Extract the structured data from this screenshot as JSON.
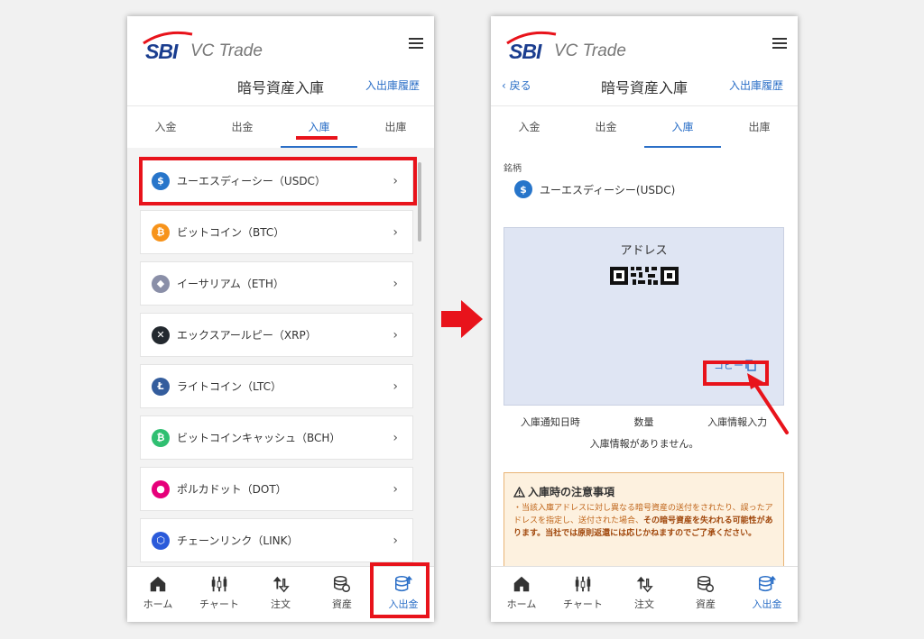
{
  "app": {
    "brand_sbi": "SBI",
    "brand_vc": "VC Trade"
  },
  "left": {
    "title": "暗号資産入庫",
    "history_link": "入出庫履歴",
    "tabs": [
      {
        "label": "入金"
      },
      {
        "label": "出金"
      },
      {
        "label": "入庫"
      },
      {
        "label": "出庫"
      }
    ],
    "active_tab": "入庫",
    "coins": [
      {
        "label": "ユーエスディーシー（USDC）",
        "icon": "usdc-icon",
        "color": "#2775ca",
        "glyph": "$"
      },
      {
        "label": "ビットコイン（BTC）",
        "icon": "btc-icon",
        "color": "#f7931a",
        "glyph": "₿"
      },
      {
        "label": "イーサリアム（ETH）",
        "icon": "eth-icon",
        "color": "#8a8fa8",
        "glyph": "◆"
      },
      {
        "label": "エックスアールピー（XRP）",
        "icon": "xrp-icon",
        "color": "#23292f",
        "glyph": "✕"
      },
      {
        "label": "ライトコイン（LTC）",
        "icon": "ltc-icon",
        "color": "#345d9d",
        "glyph": "Ł"
      },
      {
        "label": "ビットコインキャッシュ（BCH）",
        "icon": "bch-icon",
        "color": "#2fbf71",
        "glyph": "₿"
      },
      {
        "label": "ポルカドット（DOT）",
        "icon": "dot-icon",
        "color": "#e6007a",
        "glyph": "●"
      },
      {
        "label": "チェーンリンク（LINK）",
        "icon": "link-icon",
        "color": "#2a5ada",
        "glyph": "⬡"
      }
    ]
  },
  "right": {
    "back": "‹ 戻る",
    "title": "暗号資産入庫",
    "history_link": "入出庫履歴",
    "tabs": [
      {
        "label": "入金"
      },
      {
        "label": "出金"
      },
      {
        "label": "入庫"
      },
      {
        "label": "出庫"
      }
    ],
    "meigara_label": "銘柄",
    "selected_coin": "ユーエスディーシー(USDC)",
    "address_title": "アドレス",
    "copy_label": "コピー",
    "history_headers": [
      "入庫通知日時",
      "数量",
      "入庫情報入力"
    ],
    "history_empty": "入庫情報がありません。",
    "notice_title": "入庫時の注意事項",
    "notice_text_1": "・当該入庫アドレスに対し異なる暗号資産の送付をされたり、誤ったアドレスを指定し、送付された場合、",
    "notice_bold_1": "その暗号資産を失われる可能性があります。当社では原則返還には応じかねますのでご了承ください。"
  },
  "nav": [
    {
      "label": "ホーム",
      "icon": "home-icon"
    },
    {
      "label": "チャート",
      "icon": "chart-icon"
    },
    {
      "label": "注文",
      "icon": "order-icon"
    },
    {
      "label": "資産",
      "icon": "assets-icon"
    },
    {
      "label": "入出金",
      "icon": "deposit-icon"
    }
  ],
  "colors": {
    "accent": "#2b6fc7",
    "highlight": "#e8131b",
    "brand": "#1a3d8f"
  }
}
